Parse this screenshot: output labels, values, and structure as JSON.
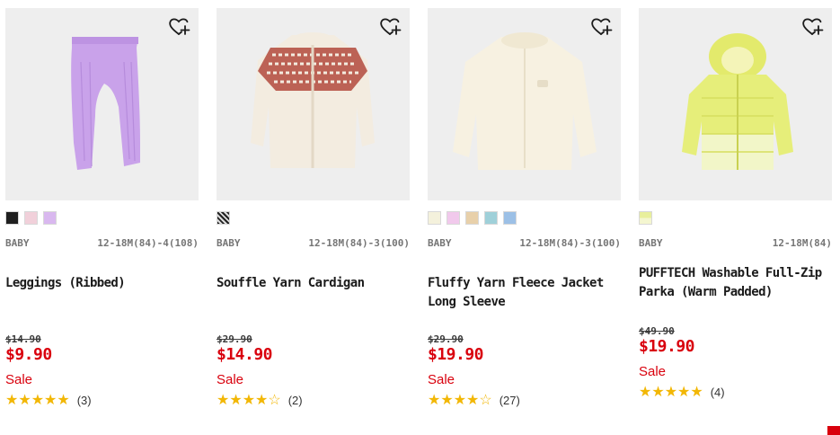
{
  "products": [
    {
      "category": "BABY",
      "size": "12-18M(84)-4(108)",
      "name": "Leggings (Ribbed)",
      "original_price": "$14.90",
      "price": "$9.90",
      "sale": "Sale",
      "stars": "★★★★★",
      "review_count": "(3)",
      "swatches": [
        "#1f1f1f",
        "#f1d0da",
        "#d9b8ef"
      ]
    },
    {
      "category": "BABY",
      "size": "12-18M(84)-3(100)",
      "name": "Souffle Yarn Cardigan",
      "original_price": "$29.90",
      "price": "$14.90",
      "sale": "Sale",
      "stars": "★★★★☆",
      "review_count": "(2)",
      "swatches": [
        "#555555"
      ]
    },
    {
      "category": "BABY",
      "size": "12-18M(84)-3(100)",
      "name": "Fluffy Yarn Fleece Jacket Long Sleeve",
      "original_price": "$29.90",
      "price": "$19.90",
      "sale": "Sale",
      "stars": "★★★★☆",
      "review_count": "(27)",
      "swatches": [
        "#f4f1dc",
        "#f1c9ec",
        "#e8d0aa",
        "#9fd0d9",
        "#9cc0e6"
      ]
    },
    {
      "category": "BABY",
      "size": "12-18M(84)",
      "name": "PUFFTECH Washable Full-Zip Parka (Warm Padded)",
      "original_price": "$49.90",
      "price": "$19.90",
      "sale": "Sale",
      "stars": "★★★★★",
      "review_count": "(4)",
      "swatches": [
        "#e8ef9c"
      ]
    }
  ],
  "icons": {
    "favorite": "heart-plus-icon"
  },
  "colors": {
    "sale_red": "#d9000d",
    "star_gold": "#f2b705",
    "image_bg": "#eeeeee"
  }
}
